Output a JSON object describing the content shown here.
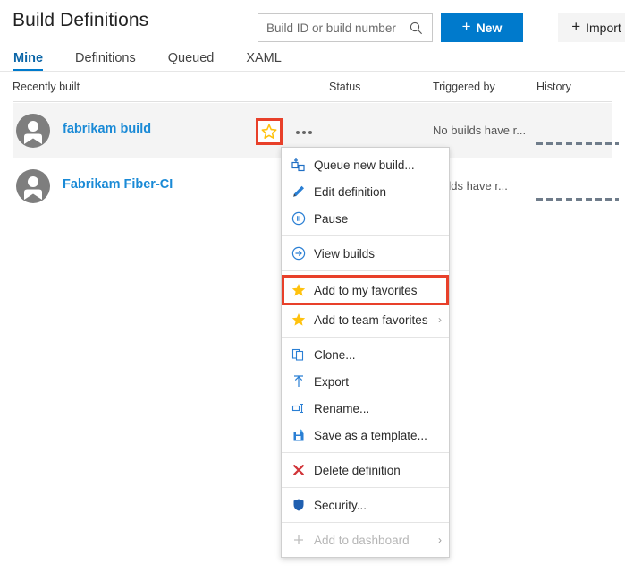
{
  "header": {
    "title": "Build Definitions",
    "search": {
      "placeholder": "Build ID or build number",
      "value": "",
      "icon": "search-icon"
    },
    "buttons": [
      {
        "label": "New",
        "icon": "plus-icon",
        "style": "primary",
        "accent": "#007acc"
      },
      {
        "label": "Import",
        "icon": "plus-icon",
        "style": "secondary",
        "accent": "#f4f4f4"
      }
    ]
  },
  "tabs": [
    {
      "label": "Mine",
      "active": true
    },
    {
      "label": "Definitions",
      "active": false
    },
    {
      "label": "Queued",
      "active": false
    },
    {
      "label": "XAML",
      "active": false
    }
  ],
  "table": {
    "columns": [
      "Recently built",
      "Status",
      "Triggered by",
      "History"
    ],
    "rows": [
      {
        "name": "fabrikam build",
        "avatar_icon": "person-avatar-icon",
        "favorite_icon": "star-outline-icon",
        "overflow_icon": "ellipsis-icon",
        "status": "",
        "triggered_by": "No builds have r...",
        "history": "history-sparkline-dashed",
        "selected": true
      },
      {
        "name": "Fabrikam Fiber-CI",
        "avatar_icon": "person-avatar-icon",
        "favorite_icon": "star-outline-icon",
        "overflow_icon": "ellipsis-icon",
        "status": "",
        "triggered_by": "builds have r...",
        "history": "history-sparkline-dashed",
        "selected": false
      }
    ]
  },
  "context_menu": {
    "items": [
      {
        "label": "Queue new build...",
        "icon": "queue-build-icon",
        "disabled": false,
        "submenu": false,
        "highlighted": false
      },
      {
        "label": "Edit definition",
        "icon": "pencil-icon",
        "disabled": false,
        "submenu": false,
        "highlighted": false
      },
      {
        "label": "Pause",
        "icon": "pause-circle-icon",
        "disabled": false,
        "submenu": false,
        "highlighted": false
      },
      {
        "separator": true
      },
      {
        "label": "View builds",
        "icon": "arrow-circle-right-icon",
        "disabled": false,
        "submenu": false,
        "highlighted": false
      },
      {
        "separator": true
      },
      {
        "label": "Add to my favorites",
        "icon": "star-filled-icon",
        "disabled": false,
        "submenu": false,
        "highlighted": true
      },
      {
        "label": "Add to team favorites",
        "icon": "star-filled-icon",
        "disabled": false,
        "submenu": true,
        "highlighted": false
      },
      {
        "separator": true
      },
      {
        "label": "Clone...",
        "icon": "copy-icon",
        "disabled": false,
        "submenu": false,
        "highlighted": false
      },
      {
        "label": "Export",
        "icon": "arrow-up-export-icon",
        "disabled": false,
        "submenu": false,
        "highlighted": false
      },
      {
        "label": "Rename...",
        "icon": "rename-icon",
        "disabled": false,
        "submenu": false,
        "highlighted": false
      },
      {
        "label": "Save as a template...",
        "icon": "save-template-icon",
        "disabled": false,
        "submenu": false,
        "highlighted": false
      },
      {
        "separator": true
      },
      {
        "label": "Delete definition",
        "icon": "red-x-icon",
        "disabled": false,
        "submenu": false,
        "highlighted": false
      },
      {
        "separator": true
      },
      {
        "label": "Security...",
        "icon": "shield-icon",
        "disabled": false,
        "submenu": false,
        "highlighted": false
      },
      {
        "separator": true
      },
      {
        "label": "Add to dashboard",
        "icon": "plus-icon",
        "disabled": true,
        "submenu": true,
        "highlighted": false
      }
    ]
  },
  "colors": {
    "accent_blue": "#007acc",
    "link_blue": "#1a8ad6",
    "highlight_red": "#e8402a",
    "star_gold": "#ffc20e",
    "row_selected_bg": "#f4f4f4",
    "delete_red": "#d13438",
    "shield_blue": "#1f5fb0"
  }
}
